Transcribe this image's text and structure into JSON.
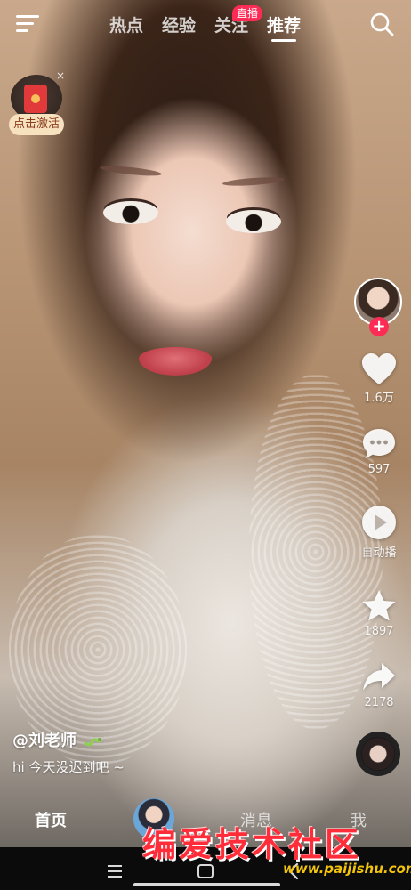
{
  "top_nav": {
    "tabs": [
      {
        "label": "热点",
        "active": false
      },
      {
        "label": "经验",
        "active": false
      },
      {
        "label": "关注",
        "active": false
      },
      {
        "label": "推荐",
        "active": true
      }
    ],
    "live_badge": "直播",
    "menu_icon": "menu-icon",
    "search_icon": "search-icon"
  },
  "redpacket": {
    "label": "点击激活",
    "close": "×",
    "icon": "red-envelope-icon"
  },
  "actions": {
    "likes": "1.6万",
    "comments": "597",
    "autoplay": "自动播",
    "favorites": "1897",
    "shares": "2178"
  },
  "post": {
    "author": "@刘老师",
    "author_emoji_icon": "snake-icon",
    "caption": "hi 今天没迟到吧 ~"
  },
  "bottom_bar": {
    "tabs": [
      {
        "label": "首页",
        "active": true
      },
      {
        "label": "消息",
        "active": false
      },
      {
        "label": "我",
        "active": false
      }
    ]
  },
  "watermark": {
    "title": "编爱技术社区",
    "url": "www.paijishu.com"
  },
  "colors": {
    "accent": "#fe2c55",
    "redpacket_bg": "#f7e2c0",
    "watermark_red": "#ff2d3a",
    "watermark_yellow": "#f2c40c"
  }
}
